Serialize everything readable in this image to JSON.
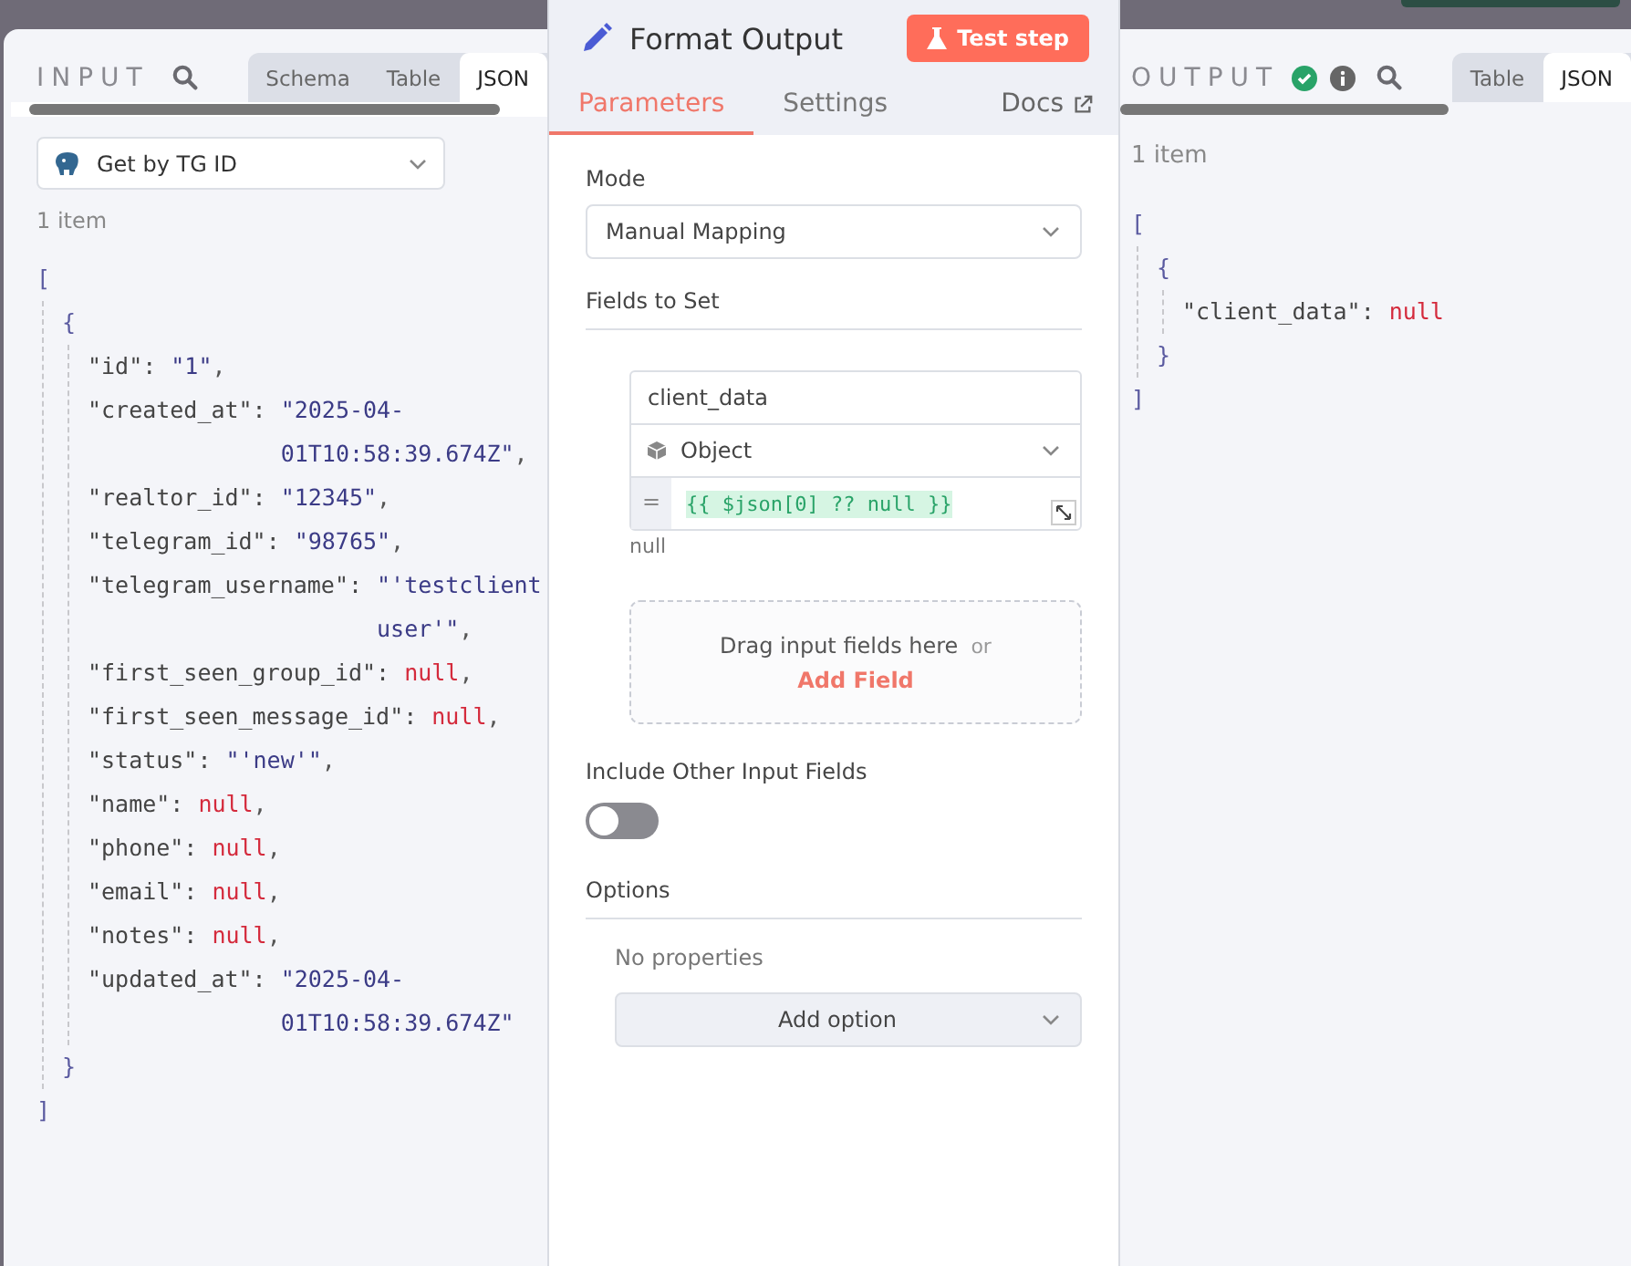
{
  "input": {
    "title": "INPUT",
    "tabs": [
      {
        "label": "Schema",
        "selected": false
      },
      {
        "label": "Table",
        "selected": false
      },
      {
        "label": "JSON",
        "selected": true
      }
    ],
    "node_select": "Get by TG ID",
    "item_count": "1 item",
    "json": {
      "open": "[",
      "objects": [
        {
          "open": "{",
          "close": "}",
          "entries": [
            {
              "key": "\"id\":",
              "value": "\"1\"",
              "kind": "string",
              "punct": ","
            },
            {
              "key": "\"created_at\":",
              "value": "\"2025-04-01T10:58:39.674Z\"",
              "kind": "string",
              "punct": ","
            },
            {
              "key": "\"realtor_id\":",
              "value": "\"12345\"",
              "kind": "string",
              "punct": ","
            },
            {
              "key": "\"telegram_id\":",
              "value": "\"98765\"",
              "kind": "string",
              "punct": ","
            },
            {
              "key": "\"telegram_username\":",
              "value": "\"'testclientuser'\"",
              "kind": "string",
              "punct": ","
            },
            {
              "key": "\"first_seen_group_id\":",
              "value": "null",
              "kind": "null",
              "punct": ","
            },
            {
              "key": "\"first_seen_message_id\":",
              "value": "null",
              "kind": "null",
              "punct": ","
            },
            {
              "key": "\"status\":",
              "value": "\"'new'\"",
              "kind": "string",
              "punct": ","
            },
            {
              "key": "\"name\":",
              "value": "null",
              "kind": "null",
              "punct": ","
            },
            {
              "key": "\"phone\":",
              "value": "null",
              "kind": "null",
              "punct": ","
            },
            {
              "key": "\"email\":",
              "value": "null",
              "kind": "null",
              "punct": ","
            },
            {
              "key": "\"notes\":",
              "value": "null",
              "kind": "null",
              "punct": ","
            },
            {
              "key": "\"updated_at\":",
              "value": "\"2025-04-01T10:58:39.674Z\"",
              "kind": "string"
            }
          ]
        }
      ],
      "close": "]"
    }
  },
  "node": {
    "title": "Format Output",
    "test_button": "Test step",
    "tabs": [
      {
        "label": "Parameters",
        "selected": true
      },
      {
        "label": "Settings",
        "selected": false
      }
    ],
    "docs_link": "Docs",
    "mode": {
      "label": "Mode",
      "value": "Manual Mapping"
    },
    "fields_heading": "Fields to Set",
    "field": {
      "name": "client_data",
      "type": "Object",
      "equals": "=",
      "expression": "{{ $json[0] ?? null }}",
      "result": "null"
    },
    "drop_zone": {
      "text": "Drag input fields here",
      "or": "or",
      "add": "Add Field"
    },
    "include_other": {
      "label": "Include Other Input Fields",
      "on": false
    },
    "options": {
      "heading": "Options",
      "empty": "No properties",
      "add": "Add option"
    }
  },
  "output": {
    "title": "OUTPUT",
    "tabs": [
      {
        "label": "Table",
        "selected": false
      },
      {
        "label": "JSON",
        "selected": true
      }
    ],
    "item_count": "1 item",
    "json": {
      "open": "[",
      "objects": [
        {
          "open": "{",
          "close": "}",
          "entries": [
            {
              "key": "\"client_data\":",
              "value": "null",
              "kind": "null"
            }
          ]
        }
      ],
      "close": "]"
    }
  }
}
